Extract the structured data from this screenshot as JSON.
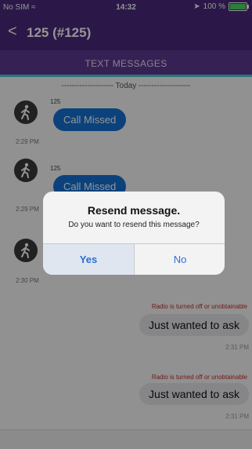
{
  "status": {
    "carrier": "No SIM",
    "time": "14:32",
    "battery": "100 %"
  },
  "nav": {
    "back": "<",
    "title": "125 (#125)"
  },
  "tab": {
    "label": "TEXT MESSAGES"
  },
  "messages": {
    "date_separator": "-------------------- Today --------------------",
    "incoming": [
      {
        "sender": "125",
        "text": "Call Missed",
        "time": "2:29 PM"
      },
      {
        "sender": "125",
        "text": "Call Missed",
        "time": "2:29 PM"
      },
      {
        "sender": "",
        "text": "",
        "time": "2:30 PM"
      }
    ],
    "outgoing": [
      {
        "error": "Radio is turned off or unobtainable",
        "text": "Just wanted to ask",
        "time": "2:31 PM"
      },
      {
        "error": "Radio is turned off or unobtainable",
        "text": "Just wanted to ask",
        "time": "2:31 PM"
      }
    ]
  },
  "alert": {
    "title": "Resend message.",
    "message": "Do you want to resend this message?",
    "yes": "Yes",
    "no": "No"
  },
  "colors": {
    "brand": "#4b2a7d",
    "accent": "#48c7d0",
    "bubble": "#1572d6",
    "action": "#2b6fd4"
  }
}
